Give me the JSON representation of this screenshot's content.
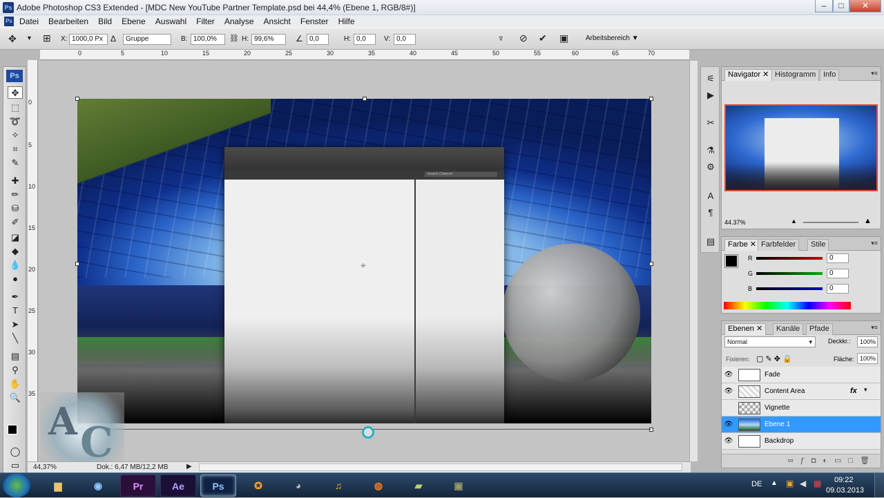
{
  "window": {
    "title": "Adobe Photoshop CS3 Extended - [MDC New YouTube Partner Template.psd bei 44,4% (Ebene 1, RGB/8#)]",
    "app_icon": "Ps",
    "controls": [
      "–",
      "□",
      "✕"
    ]
  },
  "menu": {
    "icon": "Ps",
    "items": [
      "Datei",
      "Bearbeiten",
      "Bild",
      "Ebene",
      "Auswahl",
      "Filter",
      "Analyse",
      "Ansicht",
      "Fenster",
      "Hilfe"
    ]
  },
  "options": {
    "x_label": "X:",
    "x_value": "1000,0 Px",
    "y_label": "Y:",
    "y_value": "Gruppe",
    "b_label": "B:",
    "b_value": "100,0%",
    "h_label": "H:",
    "h_value": "99,6%",
    "angle_value": "0,0",
    "hskew_label": "H:",
    "hskew_value": "0,0",
    "vskew_label": "V:",
    "vskew_value": "0,0",
    "workspace_label": "Arbeitsbereich ▼"
  },
  "rulers": {
    "top_ticks": [
      "0",
      "5",
      "10",
      "15",
      "20",
      "25",
      "30",
      "35",
      "40",
      "45",
      "50",
      "55",
      "60",
      "65",
      "70"
    ],
    "left_ticks": [
      "0",
      "5",
      "10",
      "15",
      "20",
      "25",
      "30",
      "35"
    ]
  },
  "document": {
    "search_label": "Search Channel"
  },
  "status": {
    "zoom": "44,37%",
    "doc": "Dok.: 6,47 MB/12,2 MB"
  },
  "navigator": {
    "tabs": [
      "Navigator",
      "Histogramm",
      "Info"
    ],
    "zoom": "44.37%"
  },
  "color_panel": {
    "tabs": [
      "Farbe",
      "Farbfelder",
      "Stile"
    ],
    "channels": [
      {
        "label": "R",
        "value": "0",
        "color": "#cc0000"
      },
      {
        "label": "G",
        "value": "0",
        "color": "#009900"
      },
      {
        "label": "B",
        "value": "0",
        "color": "#0000cc"
      }
    ]
  },
  "layers_panel": {
    "tabs": [
      "Ebenen",
      "Kanäle",
      "Pfade"
    ],
    "blend_mode": "Normal",
    "opacity_label": "Deckkr.:",
    "opacity_value": "100%",
    "lock_label": "Fixieren:",
    "fill_label": "Fläche:",
    "fill_value": "100%",
    "layers": [
      {
        "name": "Fade",
        "visible": true,
        "selected": false,
        "fx": ""
      },
      {
        "name": "Content Area",
        "visible": true,
        "selected": false,
        "fx": "fx"
      },
      {
        "name": "Vignette",
        "visible": false,
        "selected": false,
        "fx": ""
      },
      {
        "name": "Ebene 1",
        "visible": true,
        "selected": true,
        "fx": ""
      },
      {
        "name": "Backdrop",
        "visible": true,
        "selected": false,
        "fx": ""
      }
    ]
  },
  "taskbar": {
    "lang": "DE",
    "time": "09:22",
    "date": "09.03.2013",
    "apps": [
      "Pr",
      "Ae",
      "Ps"
    ]
  }
}
